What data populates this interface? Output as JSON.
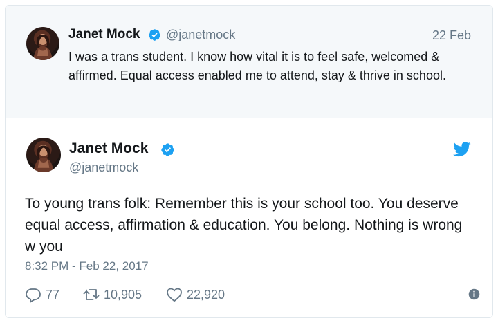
{
  "context_tweet": {
    "author_name": "Janet Mock",
    "handle": "@janetmock",
    "date": "22 Feb",
    "text": "I was a trans student. I know how vital it is to feel safe, welcomed & affirmed. Equal access enabled me to attend, stay & thrive in school.",
    "verified_icon": "verified-badge-icon"
  },
  "main_tweet": {
    "author_name": "Janet Mock",
    "handle": "@janetmock",
    "text": "To young trans folk: Remember this is your school too. You deserve equal access, affirmation & education. You belong. Nothing is wrong w you",
    "timestamp": "8:32 PM - Feb 22, 2017",
    "verified_icon": "verified-badge-icon",
    "brand_icon": "twitter-bird-icon"
  },
  "actions": {
    "replies": "77",
    "retweets": "10,905",
    "likes": "22,920",
    "icons": [
      "reply-icon",
      "retweet-icon",
      "like-heart-icon",
      "info-icon"
    ]
  },
  "colors": {
    "accent": "#1da1f2",
    "muted": "#657786",
    "text": "#14171a",
    "context_bg": "#f5f8fa",
    "border": "#e1e8ed"
  }
}
